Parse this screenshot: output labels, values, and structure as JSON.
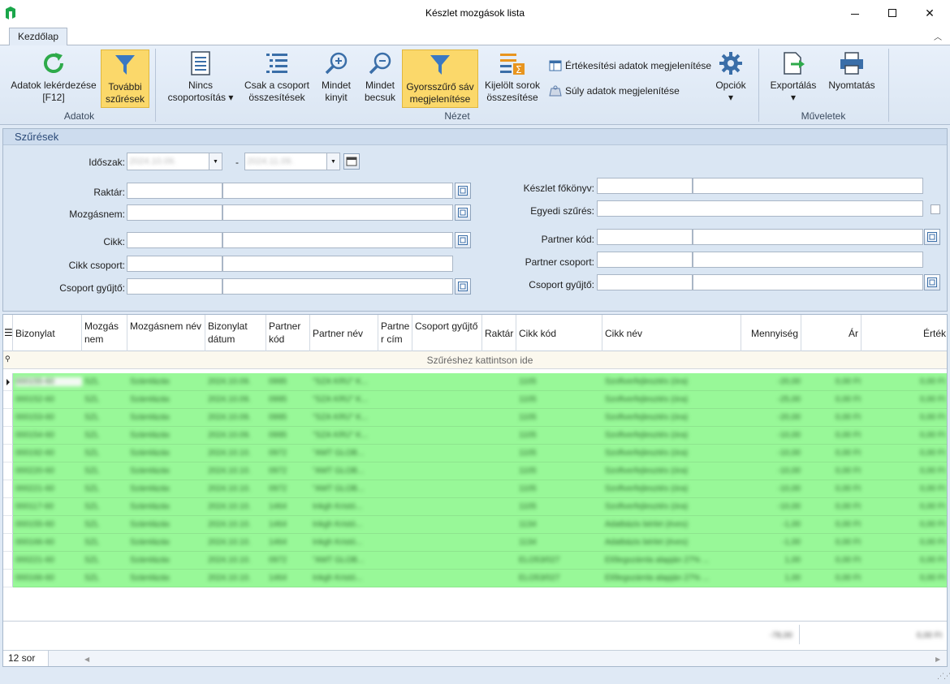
{
  "window": {
    "title": "Készlet mozgások lista",
    "close_glyph": "✕"
  },
  "tabs": [
    {
      "label": "Kezdőlap",
      "active": true
    }
  ],
  "ribbon": {
    "groups": {
      "adatok": "Adatok",
      "nezet": "Nézet",
      "muveletek": "Műveletek"
    },
    "buttons": {
      "refresh": {
        "line1": "Adatok lekérdezése",
        "line2": "[F12]"
      },
      "more_filters": {
        "line1": "További",
        "line2": "szűrések"
      },
      "no_grouping": {
        "line1": "Nincs",
        "line2": "csoportosítás ▾"
      },
      "group_totals": {
        "line1": "Csak a csoport",
        "line2": "összesítések"
      },
      "expand_all": {
        "line1": "Mindet",
        "line2": "kinyit"
      },
      "collapse_all": {
        "line1": "Mindet",
        "line2": "becsuk"
      },
      "quick_filter": {
        "line1": "Gyorsszűrő sáv",
        "line2": "megjelenítése"
      },
      "selected_totals": {
        "line1": "Kijelölt sorok",
        "line2": "összesítése"
      },
      "sales_data": "Értékesítési adatok megjelenítése",
      "weight_data": "Súly adatok megjelenítése",
      "options": {
        "line1": "Opciók",
        "line2": "▾"
      },
      "export": {
        "line1": "Exportálás",
        "line2": "▾"
      },
      "print": {
        "line1": "Nyomtatás",
        "line2": ""
      }
    }
  },
  "filters": {
    "title": "Szűrések",
    "period_label": "Időszak:",
    "period_from": "2024.10.09.",
    "period_to": "2024.11.09.",
    "period_dash": "-",
    "warehouse_label": "Raktár:",
    "movement_label": "Mozgásnem:",
    "item_label": "Cikk:",
    "item_group_label": "Cikk csoport:",
    "group_collector_label": "Csoport gyűjtő:",
    "stock_ledger_label": "Készlet főkönyv:",
    "custom_filter_label": "Egyedi szűrés:",
    "partner_code_label": "Partner kód:",
    "partner_group_label": "Partner csoport:",
    "partner_collector_label": "Csoport gyűjtő:"
  },
  "grid": {
    "headers": [
      "Bizonylat",
      "Mozgás nem",
      "Mozgásnem név",
      "Bizonylat dátum",
      "Partner kód",
      "Partner név",
      "Partne r cím",
      "Csoport gyűjtő",
      "Raktár",
      "Cikk kód",
      "Cikk név",
      "Mennyiség",
      "Ár",
      "Érték"
    ],
    "filter_row_text": "Szűréshez kattintson ide",
    "row_color": "#98f898",
    "rows": [
      [
        "000155-60",
        "SZL",
        "Számlázás",
        "2024.10.09.",
        "0995",
        "\"SZÁ KRÜ\" K...",
        "",
        "",
        "",
        "1105",
        "Szoftverfejlesztés (óra)",
        "-20,00",
        "0,00 Ft",
        "0,00 Ft"
      ],
      [
        "000152-60",
        "SZL",
        "Számlázás",
        "2024.10.09.",
        "0995",
        "\"SZÁ KRÜ\" K...",
        "",
        "",
        "",
        "1105",
        "Szoftverfejlesztés (óra)",
        "-25,00",
        "0,00 Ft",
        "0,00 Ft"
      ],
      [
        "000153-60",
        "SZL",
        "Számlázás",
        "2024.10.09.",
        "0995",
        "\"SZÁ KRÜ\" K...",
        "",
        "",
        "",
        "1105",
        "Szoftverfejlesztés (óra)",
        "-20,00",
        "0,00 Ft",
        "0,00 Ft"
      ],
      [
        "000154-60",
        "SZL",
        "Számlázás",
        "2024.10.09.",
        "0995",
        "\"SZÁ KRÜ\" K...",
        "",
        "",
        "",
        "1105",
        "Szoftverfejlesztés (óra)",
        "-10,00",
        "0,00 Ft",
        "0,00 Ft"
      ],
      [
        "000192-60",
        "SZL",
        "Számlázás",
        "2024.10.10.",
        "0972",
        "\"AMT GLOB...",
        "",
        "",
        "",
        "1105",
        "Szoftverfejlesztés (óra)",
        "-10,00",
        "0,00 Ft",
        "0,00 Ft"
      ],
      [
        "000220-60",
        "SZL",
        "Számlázás",
        "2024.10.10.",
        "0972",
        "\"AMT GLOB...",
        "",
        "",
        "",
        "1105",
        "Szoftverfejlesztés (óra)",
        "-10,00",
        "0,00 Ft",
        "0,00 Ft"
      ],
      [
        "000221-60",
        "SZL",
        "Számlázás",
        "2024.10.10.",
        "0972",
        "\"AMT GLOB...",
        "",
        "",
        "",
        "1105",
        "Szoftverfejlesztés (óra)",
        "-10,00",
        "0,00 Ft",
        "0,00 Ft"
      ],
      [
        "000117-60",
        "SZL",
        "Számlázás",
        "2024.10.10.",
        "1464",
        "Inkgh Kristó...",
        "",
        "",
        "",
        "1105",
        "Szoftverfejlesztés (óra)",
        "-10,00",
        "0,00 Ft",
        "0,00 Ft"
      ],
      [
        "000155-60",
        "SZL",
        "Számlázás",
        "2024.10.10.",
        "1464",
        "Inkgh Kristó...",
        "",
        "",
        "",
        "1134",
        "Adatbázis bérlet (éves)",
        "-1,00",
        "0,00 Ft",
        "0,00 Ft"
      ],
      [
        "000166-60",
        "SZL",
        "Számlázás",
        "2024.10.10.",
        "1464",
        "Inkgh Kristó...",
        "",
        "",
        "",
        "1134",
        "Adatbázis bérlet (éves)",
        "-1,00",
        "0,00 Ft",
        "0,00 Ft"
      ],
      [
        "000221-60",
        "SZL",
        "Számlázás",
        "2024.10.10.",
        "0972",
        "\"AMT GLOB...",
        "",
        "",
        "",
        "ELO53/027",
        "Előlegszámla alapján 27% ...",
        "1,00",
        "0,00 Ft",
        "0,00 Ft"
      ],
      [
        "000166-60",
        "SZL",
        "Számlázás",
        "2024.10.10.",
        "1464",
        "Inkgh Kristó...",
        "",
        "",
        "",
        "ELO53/027",
        "Előlegszámla alapján 27% ...",
        "1,00",
        "0,00 Ft",
        "0,00 Ft"
      ]
    ],
    "total_quantity": "-78,00",
    "total_value": "0,00 Ft",
    "row_count": "12 sor"
  }
}
